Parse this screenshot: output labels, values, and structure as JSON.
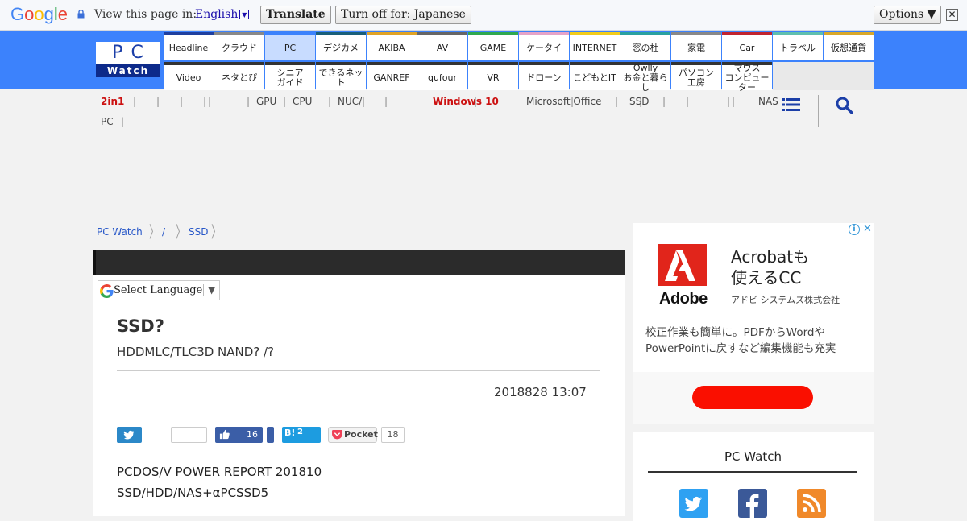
{
  "translate_bar": {
    "logo": "Google",
    "view_text": "View this page in:",
    "language": "English",
    "translate_label": "Translate",
    "turnoff_label": "Turn off for: Japanese",
    "options_label": "Options ▼",
    "close_glyph": "✕"
  },
  "site": {
    "logo_top": "PC",
    "logo_bottom": "Watch"
  },
  "nav_row1": [
    {
      "label": "Headline",
      "color": "#1f3f9e"
    },
    {
      "label": "クラウド",
      "color": "#888888"
    },
    {
      "label": "PC",
      "color": "#3c82fc",
      "active": true
    },
    {
      "label": "デジカメ",
      "color": "#1a5f7a"
    },
    {
      "label": "AKIBA",
      "color": "#e0a326"
    },
    {
      "label": "AV",
      "color": "#666666"
    },
    {
      "label": "GAME",
      "color": "#2fa84f"
    },
    {
      "label": "ケータイ",
      "color": "#e5a3c8"
    },
    {
      "label": "INTERNET",
      "color": "#f2cc1a"
    },
    {
      "label": "窓の杜",
      "color": "#2aa1a0"
    },
    {
      "label": "家電",
      "color": "#888888"
    },
    {
      "label": "Car",
      "color": "#c0242f"
    },
    {
      "label": "トラベル",
      "color": "#5fbfae"
    },
    {
      "label": "仮想通貨",
      "color": "#d9a82a"
    }
  ],
  "nav_row2": [
    {
      "label": "Video",
      "color": "#333333"
    },
    {
      "label": "ネタとぴ",
      "color": "#333333"
    },
    {
      "label": "シニア\nガイド",
      "color": "#333333"
    },
    {
      "label": "できるネット",
      "color": "#333333"
    },
    {
      "label": "GANREF",
      "color": "#333333"
    },
    {
      "label": "qufour",
      "color": "#333333"
    },
    {
      "label": "VR",
      "color": "#333333"
    },
    {
      "label": "ドローン",
      "color": "#333333"
    },
    {
      "label": "こどもとIT",
      "color": "#333333"
    },
    {
      "label": "Owlly\nお金と暮らし",
      "color": "#333333"
    },
    {
      "label": "パソコン\n工房",
      "color": "#333333"
    },
    {
      "label": "マウス\nコンピューター",
      "color": "#333333"
    }
  ],
  "subnav": {
    "row1": [
      "2in1",
      "",
      "",
      "",
      "",
      "GPU",
      "CPU",
      "NUC/",
      "",
      "",
      "Windows 10",
      "Microsoft Office",
      "SSD",
      "",
      "",
      "",
      "NAS"
    ],
    "row2": [
      "PC"
    ],
    "highlight": [
      "2in1",
      "Windows 10"
    ]
  },
  "breadcrumb": [
    "PC Watch",
    "/",
    "SSD"
  ],
  "language_widget": {
    "label": "Select Language",
    "arrow": "▼"
  },
  "article": {
    "title": "SSD?",
    "subtitle": "HDDMLC/TLC3D NAND? /?",
    "date": "2018828 13:07",
    "facebook_count": "16",
    "hatena_label": "B!",
    "hatena_count": "2",
    "pocket_label": "Pocket",
    "pocket_count": "18",
    "body_lines": [
      "PCDOS/V POWER REPORT 201810",
      "SSD/HDD/NAS+αPCSSD5"
    ]
  },
  "ad": {
    "brand": "Adobe",
    "headline_1": "Acrobatも",
    "headline_2": "使えるCC",
    "company": "アドビ システムズ株式会社",
    "desc_1": "校正作業も簡単に。PDFからWordや",
    "desc_2": "PowerPointに戻すなど編集機能も充実",
    "info_glyph": "i",
    "close_glyph": "✕"
  },
  "social": {
    "title": "PC Watch",
    "icons": [
      "twitter-icon",
      "facebook-icon",
      "rss-icon"
    ]
  }
}
